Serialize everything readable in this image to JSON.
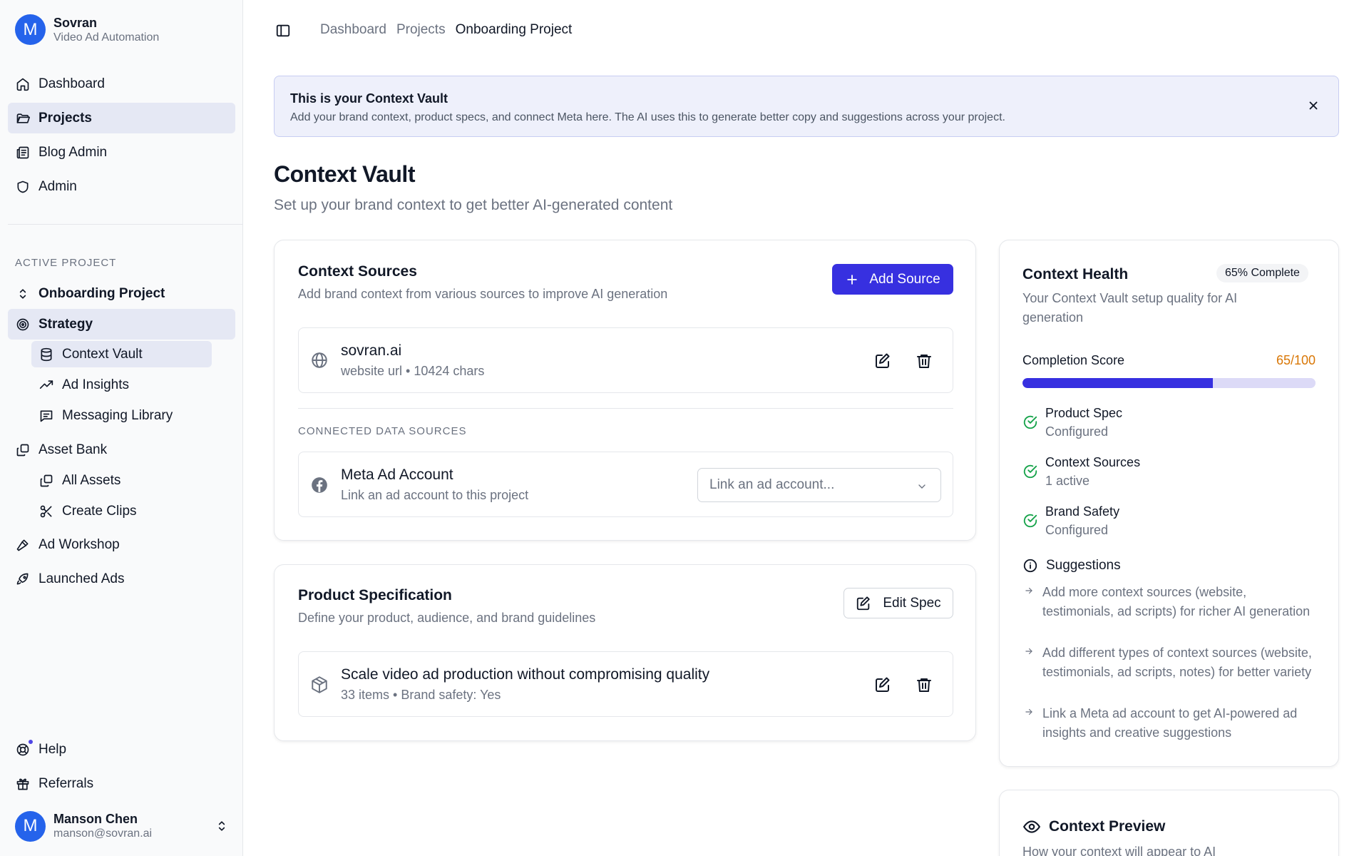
{
  "app": {
    "avatar_letter": "M",
    "name": "Sovran",
    "tagline": "Video Ad Automation"
  },
  "nav": {
    "dashboard": "Dashboard",
    "projects": "Projects",
    "blog_admin": "Blog Admin",
    "admin": "Admin"
  },
  "project": {
    "section_label": "ACTIVE PROJECT",
    "name": "Onboarding Project",
    "strategy": "Strategy",
    "context_vault": "Context Vault",
    "ad_insights": "Ad Insights",
    "messaging_library": "Messaging Library",
    "asset_bank": "Asset Bank",
    "all_assets": "All Assets",
    "create_clips": "Create Clips",
    "ad_workshop": "Ad Workshop",
    "launched_ads": "Launched Ads"
  },
  "footer_nav": {
    "help": "Help",
    "referrals": "Referrals"
  },
  "user": {
    "avatar_letter": "M",
    "name": "Manson Chen",
    "email": "manson@sovran.ai"
  },
  "breadcrumb": [
    "Dashboard",
    "Projects",
    "Onboarding Project"
  ],
  "banner": {
    "title": "This is your Context Vault",
    "text": "Add your brand context, product specs, and connect Meta here. The AI uses this to generate better copy and suggestions across your project."
  },
  "page": {
    "title": "Context Vault",
    "subtitle": "Set up your brand context to get better AI-generated content"
  },
  "context_sources": {
    "title": "Context Sources",
    "subtitle": "Add brand context from various sources to improve AI generation",
    "add_button": "Add Source",
    "source": {
      "name": "sovran.ai",
      "meta": "website url • 10424 chars"
    },
    "connected_label": "CONNECTED DATA SOURCES",
    "meta_account": {
      "name": "Meta Ad Account",
      "sub": "Link an ad account to this project",
      "select_placeholder": "Link an ad account..."
    }
  },
  "product_spec": {
    "title": "Product Specification",
    "subtitle": "Define your product, audience, and brand guidelines",
    "edit_button": "Edit Spec",
    "spec": {
      "name": "Scale video ad production without compromising quality",
      "meta": "33 items • Brand safety: Yes"
    }
  },
  "context_health": {
    "title": "Context Health",
    "badge": "65% Complete",
    "subtitle_line1": "Your Context Vault setup quality for AI",
    "subtitle_line2": "generation",
    "score_label": "Completion Score",
    "score_value": "65/100",
    "progress_percent": 65,
    "checks": [
      {
        "title": "Product Spec",
        "status": "Configured"
      },
      {
        "title": "Context Sources",
        "status": "1 active"
      },
      {
        "title": "Brand Safety",
        "status": "Configured"
      }
    ],
    "suggestions_title": "Suggestions",
    "suggestions": [
      "Add more context sources (website, testimonials, ad scripts) for richer AI generation",
      "Add different types of context sources (website, testimonials, ad scripts, notes) for better variety",
      "Link a Meta ad account to get AI-powered ad insights and creative suggestions"
    ]
  },
  "context_preview": {
    "title": "Context Preview",
    "subtitle": "How your context will appear to AI"
  },
  "colors": {
    "accent": "#3730e0",
    "active_nav_bg": "#e5e8f4",
    "success": "#16a34a",
    "score_text": "#d97706",
    "banner_bg": "#eef0fb"
  }
}
